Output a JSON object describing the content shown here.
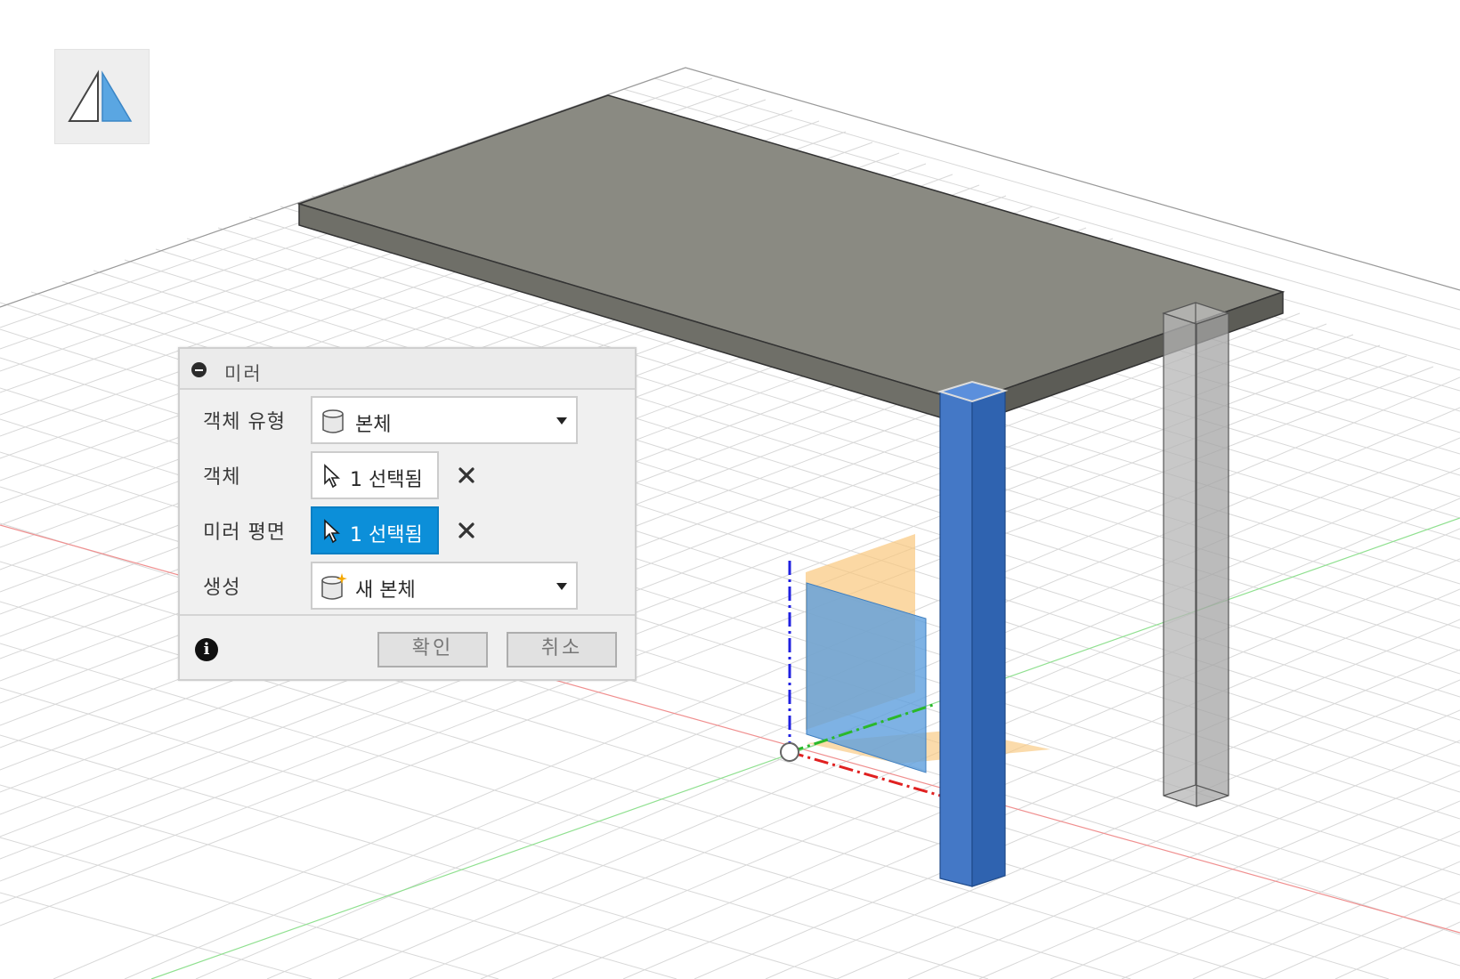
{
  "tool": {
    "icon": "mirror-icon"
  },
  "dialog": {
    "title": "미러",
    "rows": {
      "object_type": {
        "label": "객체 유형",
        "value": "본체",
        "icon": "body-icon"
      },
      "objects": {
        "label": "객체",
        "value": "1 선택됨",
        "icon": "cursor-icon"
      },
      "mirror_plane": {
        "label": "미러 평면",
        "value": "1 선택됨",
        "icon": "cursor-icon"
      },
      "operation": {
        "label": "생성",
        "value": "새 본체",
        "icon": "new-body-icon"
      }
    },
    "buttons": {
      "ok": "확인",
      "cancel": "취소"
    }
  },
  "colors": {
    "accent": "#0c8fd9",
    "selected_body": "#3f79c9",
    "plane_orange": "#f9c77e",
    "plane_blue": "#5e9fdd",
    "tabletop": "#8a8a82",
    "axis_x": "#e02020",
    "axis_y": "#2ab82a",
    "axis_z": "#2020e0"
  }
}
